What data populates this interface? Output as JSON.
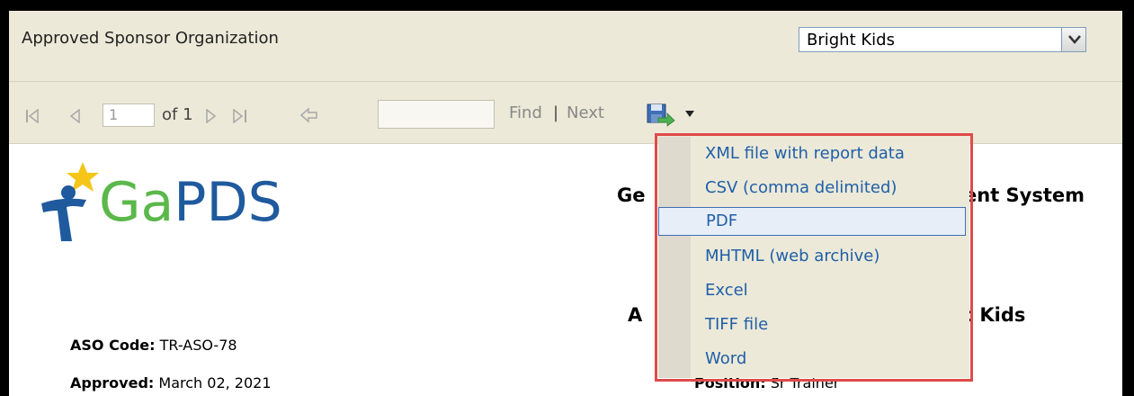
{
  "parameters": {
    "label": "Approved Sponsor Organization",
    "selected_value": "Bright Kids"
  },
  "toolbar": {
    "page_value": "1",
    "of_label": "of 1",
    "find_label": "Find",
    "separator": "|",
    "next_label": "Next"
  },
  "export_menu": {
    "items": [
      "XML file with report data",
      "CSV (comma delimited)",
      "PDF",
      "MHTML (web archive)",
      "Excel",
      "TIFF file",
      "Word"
    ],
    "selected": "PDF"
  },
  "report": {
    "logo_text_ga": "Ga",
    "logo_text_pds": "PDS",
    "title_left": "Ge",
    "title_right": "ent System",
    "subtitle_left": "A",
    "subtitle_right": "t Kids",
    "aso_code_label": "ASO Code:",
    "aso_code_value": "TR-ASO-78",
    "approved_label": "Approved:",
    "approved_value": "March 02, 2021",
    "position_label": "Position:",
    "position_value": "Sr Trainer"
  },
  "colors": {
    "highlight_outline": "#e04a4a",
    "link_blue": "#1f5fa8",
    "logo_green": "#5bb84a",
    "logo_blue": "#1f5a9e",
    "star_yellow": "#f5c518"
  }
}
